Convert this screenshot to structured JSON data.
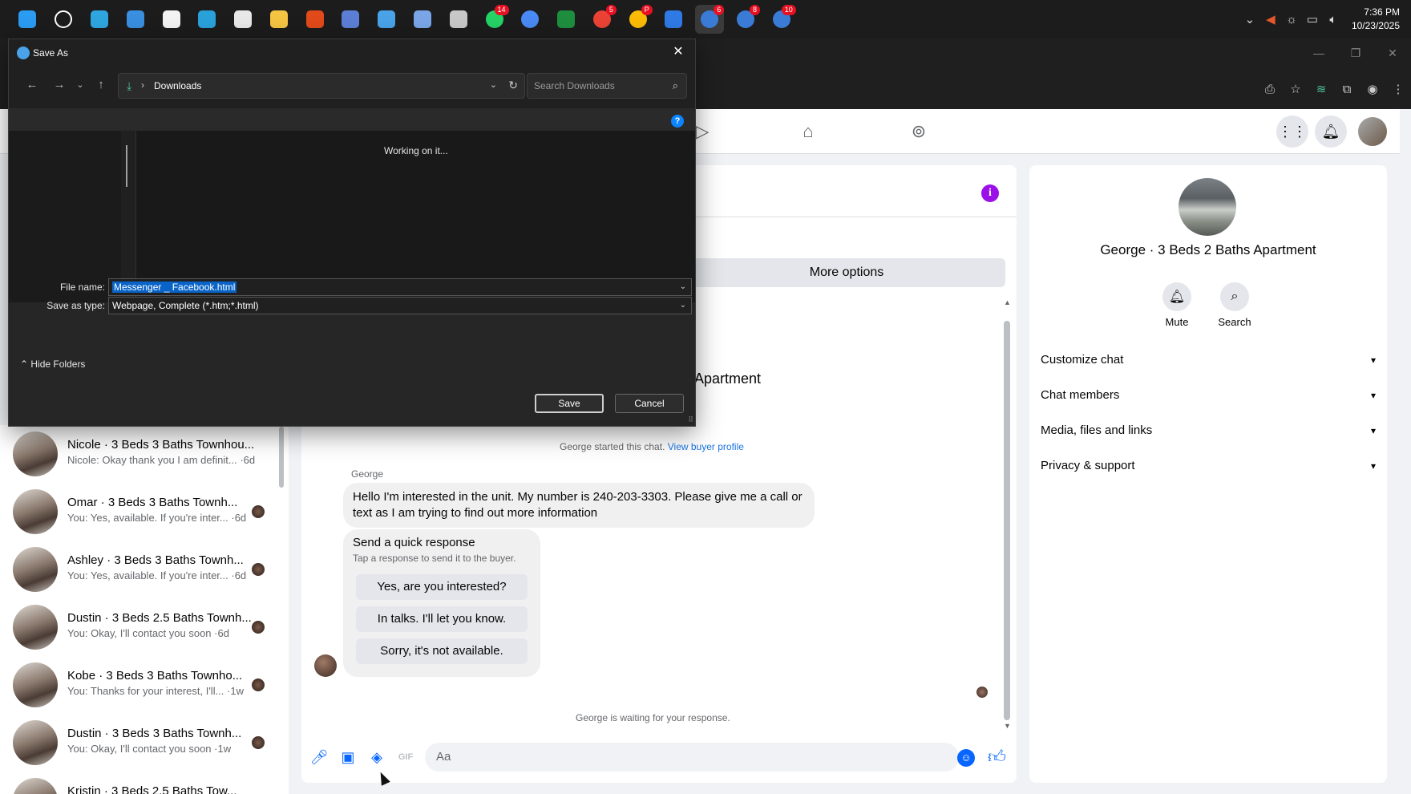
{
  "taskbar": {
    "apps": [
      {
        "icon": "windows-start-icon",
        "color": "#2b9cf2"
      },
      {
        "icon": "search-icon",
        "color": "#ffffff"
      },
      {
        "icon": "edge-icon",
        "color": "#2fa6e0"
      },
      {
        "icon": "mail-icon",
        "color": "#3a8fe0"
      },
      {
        "icon": "store-icon",
        "color": "#f3f3f3"
      },
      {
        "icon": "telegram-icon",
        "color": "#2aa1da"
      },
      {
        "icon": "app-window-icon",
        "color": "#e8e8e8"
      },
      {
        "icon": "file-explorer-icon",
        "color": "#f4c542"
      },
      {
        "icon": "app-orange-icon",
        "color": "#e24a1a"
      },
      {
        "icon": "app-panel-icon",
        "color": "#5c7fd6"
      },
      {
        "icon": "notepad-icon",
        "color": "#4aa3e8"
      },
      {
        "icon": "snipping-icon",
        "color": "#7aa6e8"
      },
      {
        "icon": "game-icon",
        "color": "#c8c8c8"
      },
      {
        "icon": "whatsapp-icon",
        "color": "#25d366",
        "badge": "14"
      },
      {
        "icon": "app-circle-icon",
        "color": "#4a8af4"
      },
      {
        "icon": "app-green-icon",
        "color": "#1e8f3e"
      },
      {
        "icon": "chrome-icon",
        "color": "#ea4335",
        "badge": "5"
      },
      {
        "icon": "chrome-profile-icon",
        "color": "#fbbc05",
        "badge": "P"
      },
      {
        "icon": "app-drop-icon",
        "color": "#2f7ae5"
      },
      {
        "icon": "chrome-instance-icon",
        "color": "#3a7bd5",
        "badge": "6",
        "active": true
      },
      {
        "icon": "chrome-instance-icon",
        "color": "#3a7bd5",
        "badge": "8"
      },
      {
        "icon": "chrome-instance-icon",
        "color": "#3a7bd5",
        "badge": "10"
      }
    ],
    "tray_icons": [
      "chevron-up-icon",
      "volume-muted-icon",
      "brightness-icon",
      "network-icon",
      "speaker-icon"
    ],
    "time": "7:36 PM",
    "date": "10/23/2025"
  },
  "dialog": {
    "title": "Save As",
    "address_path": "Downloads",
    "search_placeholder": "Search Downloads",
    "status": "Working on it...",
    "file_name_label": "File name:",
    "file_name_value": "Messenger _ Facebook.html",
    "save_type_label": "Save as type:",
    "save_type_value": "Webpage, Complete (*.htm;*.html)",
    "hide_folders": "Hide Folders",
    "save_label": "Save",
    "cancel_label": "Cancel"
  },
  "chat_list": [
    {
      "name": "Nicole · 3 Beds 3 Baths Townhou...",
      "preview": "Nicole: Okay thank you I am definit... ·6d"
    },
    {
      "name": "Omar · 3 Beds 3 Baths Townh...",
      "preview": "You: Yes, available. If you're inter... ·6d"
    },
    {
      "name": "Ashley · 3 Beds 3 Baths Townh...",
      "preview": "You: Yes, available. If you're inter... ·6d"
    },
    {
      "name": "Dustin · 3 Beds 2.5 Baths Townh...",
      "preview": "You: Okay, I'll contact you soon ·6d"
    },
    {
      "name": "Kobe · 3 Beds 3 Baths Townho...",
      "preview": "You: Thanks for your interest, I'll... ·1w"
    },
    {
      "name": "Dustin · 3 Beds 3 Baths Townh...",
      "preview": "You: Okay, I'll contact you soon ·1w"
    },
    {
      "name": "Kristin · 3 Beds 2.5 Baths Tow...",
      "preview": ""
    }
  ],
  "conversation": {
    "more_options": "More options",
    "listing_title": "Apartment",
    "started_text": "George started this chat.",
    "buyer_profile_link": "View buyer profile",
    "sender": "George",
    "message": "Hello I'm interested in the unit. My number is 240-203-3303. Please give me a call or text as I am trying to find out more information",
    "quick_response_title": "Send a quick response",
    "quick_response_sub": "Tap a response to send it to the buyer.",
    "quick_responses": [
      "Yes, are you interested?",
      "In talks. I'll let you know.",
      "Sorry, it's not available."
    ],
    "waiting": "George is waiting for your response.",
    "composer_placeholder": "Aa"
  },
  "info_panel": {
    "name": "George · 3 Beds 2 Baths Apartment",
    "actions": [
      {
        "label": "Mute",
        "icon": "bell-icon"
      },
      {
        "label": "Search",
        "icon": "search-icon"
      }
    ],
    "sections": [
      "Customize chat",
      "Chat members",
      "Media, files and links",
      "Privacy & support"
    ]
  }
}
